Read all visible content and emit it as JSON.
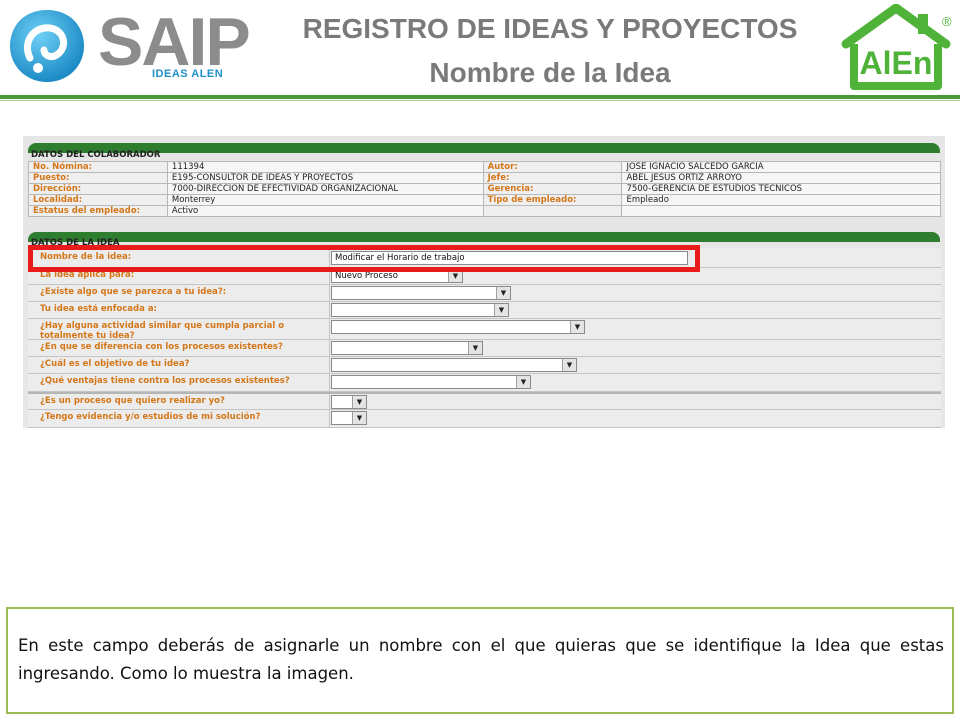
{
  "header": {
    "logo_left": {
      "word": "SAIP",
      "sub": "IDEAS ALEN",
      "icon": "saip-drop-logo"
    },
    "title": "REGISTRO DE IDEAS Y PROYECTOS",
    "subtitle": "Nombre de la Idea",
    "logo_right": {
      "word": "AlEn",
      "mark": "®",
      "icon": "alen-house-logo"
    },
    "rule_color": "#4a9a3a"
  },
  "colaborador": {
    "section_title": "DATOS DEL COLABORADOR",
    "rows": [
      {
        "label1": "No. Nómina:",
        "value1": "111394",
        "label2": "Autor:",
        "value2": "JOSE IGNACIO SALCEDO GARCIA"
      },
      {
        "label1": "Puesto:",
        "value1": "E195-CONSULTOR DE IDEAS Y PROYECTOS",
        "label2": "Jefe:",
        "value2": "ABEL JESUS ORTIZ ARROYO"
      },
      {
        "label1": "Dirección:",
        "value1": "7000-DIRECCION DE EFECTIVIDAD ORGANIZACIONAL",
        "label2": "Gerencia:",
        "value2": "7500-GERENCIA DE ESTUDIOS TECNICOS"
      },
      {
        "label1": "Localidad:",
        "value1": "Monterrey",
        "label2": "Tipo de empleado:",
        "value2": "Empleado"
      },
      {
        "label1": "Estatus del empleado:",
        "value1": "Activo",
        "label2": "",
        "value2": ""
      }
    ]
  },
  "idea": {
    "section_title": "DATOS DE LA IDEA",
    "name_label": "Nombre de la idea:",
    "name_value": "Modificar el Horario de trabajo",
    "questions": [
      {
        "label": "La idea aplica para:",
        "value": "Nuevo Proceso"
      },
      {
        "label": "¿Existe algo que se parezca a tu idea?:",
        "value": ""
      },
      {
        "label": "Tu idea está enfocada a:",
        "value": ""
      },
      {
        "label": "¿Hay alguna actividad similar que cumpla parcial o totalmente tu idea?",
        "value": ""
      },
      {
        "label": "¿En que se diferencia con los procesos existentes?",
        "value": ""
      },
      {
        "label": "¿Cuál es el objetivo de tu idea?",
        "value": ""
      },
      {
        "label": "¿Qué ventajas tiene contra los procesos existentes?",
        "value": ""
      },
      {
        "label": "¿Es un proceso que quiero realizar yo?",
        "value": ""
      },
      {
        "label": "¿Tengo evidencia y/o estudios de mi solución?",
        "value": ""
      }
    ],
    "dropdown_arrow": "▼"
  },
  "highlight_color": "#e81a1a",
  "caption": {
    "text": "En este campo deberás de asignarle un nombre con el que quieras que se identifique la Idea que estas ingresando. Como lo muestra la imagen.",
    "border_color": "#9bbb59"
  }
}
